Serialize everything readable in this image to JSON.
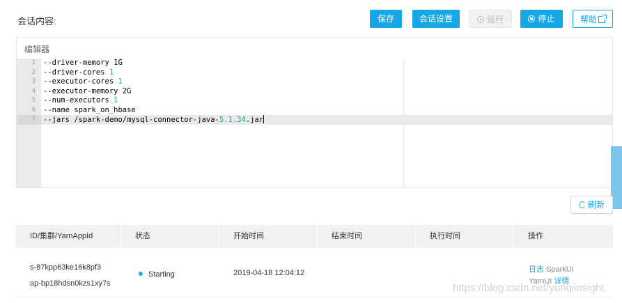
{
  "header": {
    "title": "会话内容:",
    "buttons": {
      "save": "保存",
      "session_settings": "会话设置",
      "run": "运行",
      "stop": "停止",
      "help": "帮助"
    }
  },
  "editor": {
    "label": "编辑器",
    "lines": [
      {
        "n": "1",
        "text": "--driver-memory 1G"
      },
      {
        "n": "2",
        "pre": "--driver-cores ",
        "num": "1"
      },
      {
        "n": "3",
        "pre": "--executor-cores ",
        "num": "1"
      },
      {
        "n": "4",
        "text": "--executor-memory 2G"
      },
      {
        "n": "5",
        "pre": "--num-executors ",
        "num": "1"
      },
      {
        "n": "6",
        "text": "--name spark_on_hbase"
      },
      {
        "n": "7",
        "pre": "--jars /spark-demo/mysql-connector-java-",
        "num": "5.1.34",
        "post": ".jar"
      }
    ],
    "active_line": "7"
  },
  "refresh_label": "刷新",
  "table": {
    "headers": [
      "ID/集群/YarnAppId",
      "状态",
      "开始时间",
      "结束时间",
      "执行时间",
      "操作"
    ],
    "rows": [
      {
        "id": "s-87kpp63ke16k8pf3",
        "cluster": "ap-bp18hdsn0kzs1xy7s",
        "status": "Starting",
        "start_time": "2019-04-18 12:04:12",
        "end_time": "",
        "duration": "",
        "ops": {
          "log": "日志",
          "spark_ui": "SparkUI",
          "yarn_ui": "YarnUI",
          "detail": "详情"
        }
      }
    ]
  },
  "watermark": "https://blog.csdn.net/yunqiinsight",
  "colors": {
    "primary": "#16a8e6",
    "status_dot": "#17b5c9",
    "number": "#1aa3a3"
  }
}
